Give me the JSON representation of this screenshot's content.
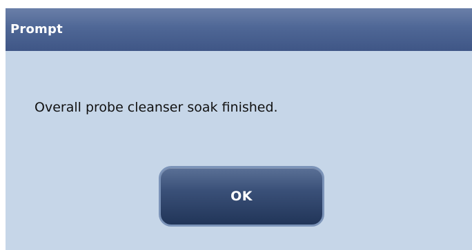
{
  "dialog": {
    "title": "Prompt",
    "message": "Overall probe cleanser soak finished.",
    "ok_label": "OK"
  },
  "colors": {
    "titlebar": "#4f6796",
    "body": "#c6d6e8",
    "button": "#3a5078",
    "button_border": "#7b93b8"
  }
}
